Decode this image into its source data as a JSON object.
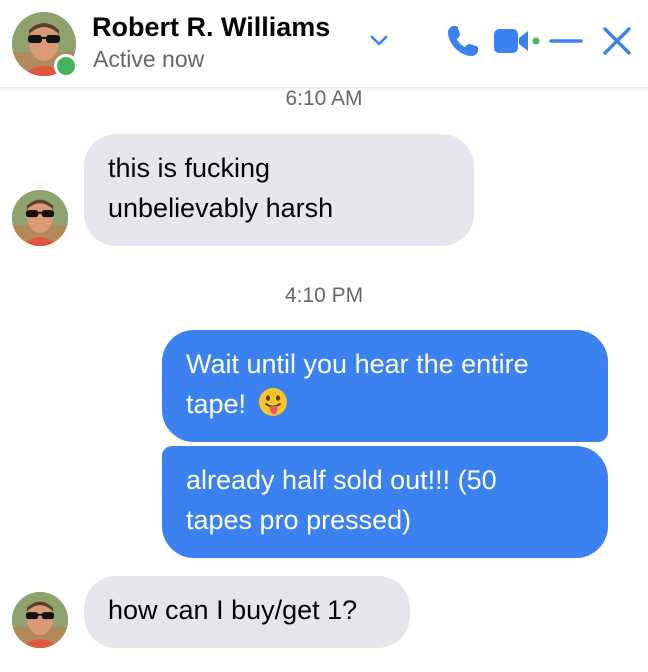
{
  "header": {
    "contact_name": "Robert R. Williams",
    "status": "Active now",
    "icons": [
      "chevron-down-icon",
      "phone-icon",
      "video-camera-icon",
      "minimize-icon",
      "close-icon"
    ],
    "accent_color": "#3b82f0",
    "online_color": "#44b35a"
  },
  "messages": {
    "time_1": "6:10 AM",
    "msg_1_line_1": "this is fucking",
    "msg_1_line_2": "unbelievably harsh",
    "time_2": "4:10 PM",
    "msg_2_line_1": "Wait until you hear the entire",
    "msg_2_line_2": "tape!",
    "msg_2_emoji": "face-with-tongue-emoji",
    "msg_3_line_1": "already half sold out!!! (50",
    "msg_3_line_2": "tapes pro pressed)",
    "msg_4": "how can I buy/get 1?"
  }
}
